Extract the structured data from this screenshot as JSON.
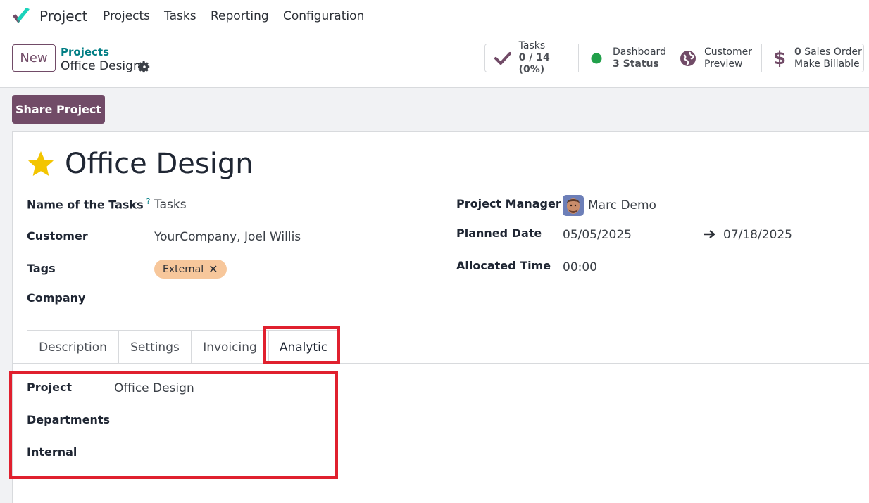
{
  "nav": {
    "app_name": "Project",
    "items": [
      "Projects",
      "Tasks",
      "Reporting",
      "Configuration"
    ]
  },
  "control": {
    "new_label": "New",
    "breadcrumb_parent": "Projects",
    "breadcrumb_current": "Office Design",
    "stats": [
      {
        "icon": "check-icon",
        "line1": "Tasks",
        "line2": "0 / 14 (0%)"
      },
      {
        "icon": "green-dot-icon",
        "line1": "Dashboard",
        "line2": "3 Status"
      },
      {
        "icon": "globe-icon",
        "line1": "Customer",
        "line2": "Preview"
      },
      {
        "icon": "dollar-icon",
        "line1_bold": "0",
        "line1": " Sales Order",
        "line2": "Make Billable"
      }
    ]
  },
  "share_label": "Share Project",
  "form": {
    "title": "Office Design",
    "left": {
      "name_of_tasks_label": "Name of the Tasks",
      "name_of_tasks_help": "?",
      "name_of_tasks_value": "Tasks",
      "customer_label": "Customer",
      "customer_value": "YourCompany, Joel Willis",
      "tags_label": "Tags",
      "tag_value": "External",
      "company_label": "Company"
    },
    "right": {
      "manager_label": "Project Manager",
      "manager_value": "Marc Demo",
      "planned_label": "Planned Date",
      "planned_start": "05/05/2025",
      "planned_end": "07/18/2025",
      "allocated_label": "Allocated Time",
      "allocated_value": "00:00"
    }
  },
  "tabs": [
    "Description",
    "Settings",
    "Invoicing",
    "Analytic"
  ],
  "analytic": {
    "project_label": "Project",
    "project_value": "Office Design",
    "departments_label": "Departments",
    "internal_label": "Internal"
  },
  "colors": {
    "brand": "#714b67",
    "link": "#017e84",
    "highlight": "#e0202e",
    "tag": "#f7c79b",
    "star": "#f3c500"
  }
}
